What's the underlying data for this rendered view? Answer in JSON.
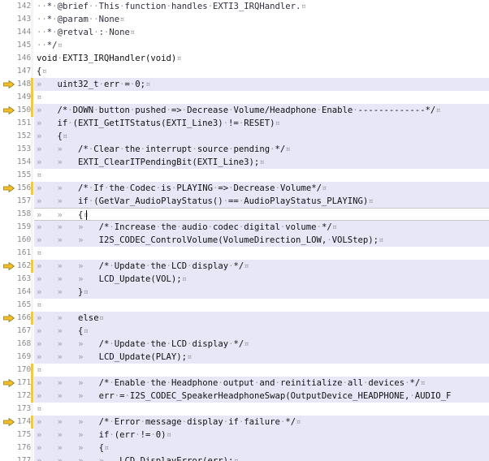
{
  "editor": {
    "lines": [
      {
        "num": "142",
        "text": "··*·@brief··This·function·handles·EXTI3_IRQHandler.¤",
        "hl": false,
        "cur": false,
        "marker": false,
        "changed": false,
        "comment": true
      },
      {
        "num": "143",
        "text": "··*·@param··None¤",
        "hl": false,
        "cur": false,
        "marker": false,
        "changed": false,
        "comment": true
      },
      {
        "num": "144",
        "text": "··*·@retval·:·None¤",
        "hl": false,
        "cur": false,
        "marker": false,
        "changed": false,
        "comment": true
      },
      {
        "num": "145",
        "text": "··*/¤",
        "hl": false,
        "cur": false,
        "marker": false,
        "changed": false,
        "comment": true
      },
      {
        "num": "146",
        "text": "void·EXTI3_IRQHandler(void)¤",
        "hl": false,
        "cur": false,
        "marker": false,
        "changed": false,
        "comment": false
      },
      {
        "num": "147",
        "text": "{¤",
        "hl": false,
        "cur": false,
        "marker": false,
        "changed": false,
        "comment": false
      },
      {
        "num": "148",
        "text": "»   uint32_t·err·=·0;¤",
        "hl": true,
        "cur": false,
        "marker": true,
        "changed": true,
        "comment": false
      },
      {
        "num": "149",
        "text": "¤",
        "hl": false,
        "cur": false,
        "marker": false,
        "changed": true,
        "comment": false
      },
      {
        "num": "150",
        "text": "»   /*·DOWN·button·pushed·=>·Decrease·Volume/Headphone·Enable·-------------*/¤",
        "hl": true,
        "cur": false,
        "marker": true,
        "changed": true,
        "comment": false
      },
      {
        "num": "151",
        "text": "»   if·(EXTI_GetITStatus(EXTI_Line3)·!=·RESET)¤",
        "hl": true,
        "cur": false,
        "marker": false,
        "changed": false,
        "comment": false
      },
      {
        "num": "152",
        "text": "»   {¤",
        "hl": true,
        "cur": false,
        "marker": false,
        "changed": false,
        "comment": false
      },
      {
        "num": "153",
        "text": "»   »   /*·Clear·the·interrupt·source·pending·*/¤",
        "hl": true,
        "cur": false,
        "marker": false,
        "changed": false,
        "comment": false
      },
      {
        "num": "154",
        "text": "»   »   EXTI_ClearITPendingBit(EXTI_Line3);¤",
        "hl": true,
        "cur": false,
        "marker": false,
        "changed": false,
        "comment": false
      },
      {
        "num": "155",
        "text": "¤",
        "hl": false,
        "cur": false,
        "marker": false,
        "changed": false,
        "comment": false
      },
      {
        "num": "156",
        "text": "»   »   /*·If·the·Codec·is·PLAYING·=>·Decrease·Volume*/¤",
        "hl": true,
        "cur": false,
        "marker": true,
        "changed": true,
        "comment": false
      },
      {
        "num": "157",
        "text": "»   »   if·(GetVar_AudioPlayStatus()·==·AudioPlayStatus_PLAYING)¤",
        "hl": true,
        "cur": false,
        "marker": false,
        "changed": false,
        "comment": false
      },
      {
        "num": "158",
        "text": "»   »   {¤",
        "hl": false,
        "cur": true,
        "marker": false,
        "changed": false,
        "comment": false
      },
      {
        "num": "159",
        "text": "»   »   »   /*·Increase·the·audio·codec·digital·volume·*/¤",
        "hl": true,
        "cur": false,
        "marker": false,
        "changed": false,
        "comment": false
      },
      {
        "num": "160",
        "text": "»   »   »   I2S_CODEC_ControlVolume(VolumeDirection_LOW,·VOLStep);¤",
        "hl": true,
        "cur": false,
        "marker": false,
        "changed": false,
        "comment": false
      },
      {
        "num": "161",
        "text": "¤",
        "hl": false,
        "cur": false,
        "marker": false,
        "changed": false,
        "comment": false
      },
      {
        "num": "162",
        "text": "»   »   »   /*·Update·the·LCD·display·*/¤",
        "hl": true,
        "cur": false,
        "marker": true,
        "changed": true,
        "comment": false
      },
      {
        "num": "163",
        "text": "»   »   »   LCD_Update(VOL);¤",
        "hl": true,
        "cur": false,
        "marker": false,
        "changed": false,
        "comment": false
      },
      {
        "num": "164",
        "text": "»   »   }¤",
        "hl": true,
        "cur": false,
        "marker": false,
        "changed": false,
        "comment": false
      },
      {
        "num": "165",
        "text": "¤",
        "hl": false,
        "cur": false,
        "marker": false,
        "changed": false,
        "comment": false
      },
      {
        "num": "166",
        "text": "»   »   else¤",
        "hl": true,
        "cur": false,
        "marker": true,
        "changed": true,
        "comment": false
      },
      {
        "num": "167",
        "text": "»   »   {¤",
        "hl": true,
        "cur": false,
        "marker": false,
        "changed": false,
        "comment": false
      },
      {
        "num": "168",
        "text": "»   »   »   /*·Update·the·LCD·display·*/¤",
        "hl": true,
        "cur": false,
        "marker": false,
        "changed": false,
        "comment": false
      },
      {
        "num": "169",
        "text": "»   »   »   LCD_Update(PLAY);¤",
        "hl": true,
        "cur": false,
        "marker": false,
        "changed": false,
        "comment": false
      },
      {
        "num": "170",
        "text": "¤",
        "hl": false,
        "cur": false,
        "marker": false,
        "changed": true,
        "comment": false
      },
      {
        "num": "171",
        "text": "»   »   »   /*·Enable·the·Headphone·output·and·reinitialize·all·devices·*/¤",
        "hl": true,
        "cur": false,
        "marker": true,
        "changed": true,
        "comment": false
      },
      {
        "num": "172",
        "text": "»   »   »   err·=·I2S_CODEC_SpeakerHeadphoneSwap(OutputDevice_HEADPHONE,·AUDIO_F",
        "hl": true,
        "cur": false,
        "marker": false,
        "changed": true,
        "comment": false
      },
      {
        "num": "173",
        "text": "¤",
        "hl": false,
        "cur": false,
        "marker": false,
        "changed": false,
        "comment": false
      },
      {
        "num": "174",
        "text": "»   »   »   /*·Error·message·display·if·failure·*/¤",
        "hl": true,
        "cur": false,
        "marker": true,
        "changed": true,
        "comment": false
      },
      {
        "num": "175",
        "text": "»   »   »   if·(err·!=·0)¤",
        "hl": true,
        "cur": false,
        "marker": false,
        "changed": false,
        "comment": false
      },
      {
        "num": "176",
        "text": "»   »   »   {¤",
        "hl": true,
        "cur": false,
        "marker": false,
        "changed": false,
        "comment": false
      },
      {
        "num": "177",
        "text": "»   »   »   »   LCD_DisplayError(err);¤",
        "hl": true,
        "cur": false,
        "marker": false,
        "changed": false,
        "comment": false
      }
    ]
  },
  "colors": {
    "highlight": "#e7e7f8",
    "marker_arrow": "#f2c024",
    "change_bar": "#f2c84b",
    "whitespace": "#a0a0a0"
  },
  "icons": {
    "marker": "bookmark-arrow-icon",
    "caret": "text-caret"
  }
}
